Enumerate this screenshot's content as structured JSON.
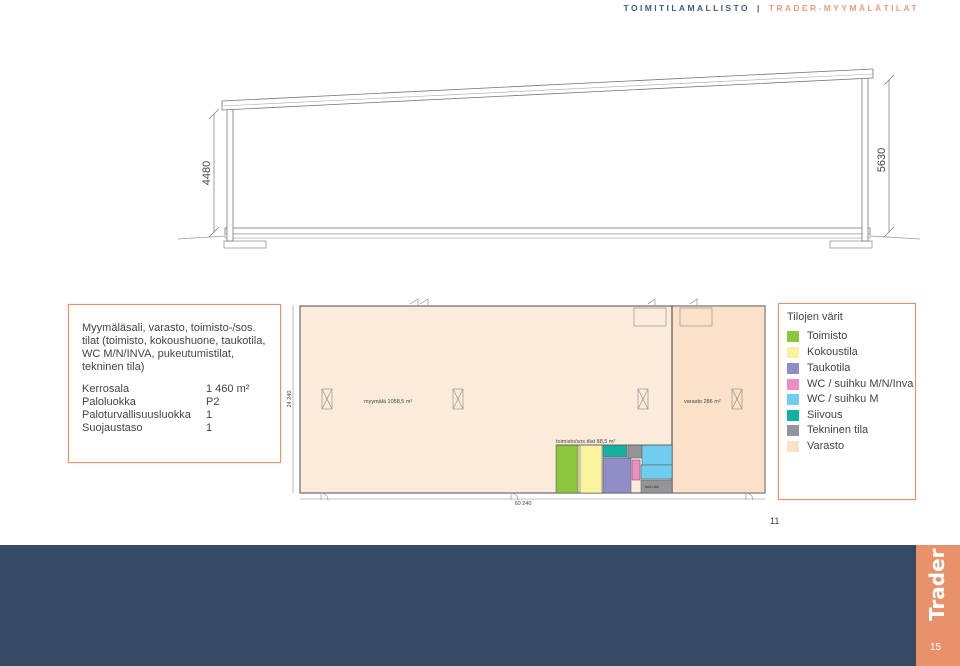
{
  "header": {
    "series": "TOIMITILAMALLISTO",
    "separator": "|",
    "section": "TRADER-MYYMÄLÄTILAT"
  },
  "section_drawing": {
    "height_left": "4480",
    "height_right": "5630"
  },
  "info": {
    "description": "Myymäläsali, varasto, toimisto-/sos. tilat (toimisto, kokoushuone, taukotila, WC M/N/INVA, pukeutumistilat, tekninen tila)",
    "rows": [
      {
        "label": "Kerrosala",
        "value": "1 460 m²"
      },
      {
        "label": "Paloluokka",
        "value": "P2"
      },
      {
        "label": "Paloturvallisuusluokka",
        "value": "1"
      },
      {
        "label": "Suojaustaso",
        "value": "1"
      }
    ]
  },
  "floorplan": {
    "shop_label": "myymälä 1058,5 m²",
    "storage_label": "varasto 286 m²",
    "office_label": "toimisto/sos.tilat 88,5 m²",
    "tech_label": "tekn.tila",
    "dim_width": "60 240",
    "dim_depth": "24 240",
    "colors": {
      "shop": "#fbebda",
      "storage": "#fbe1c8",
      "wall": "#6a6a6a"
    }
  },
  "legend": {
    "title": "Tilojen värit",
    "items": [
      {
        "label": "Toimisto",
        "color": "#8cc63f"
      },
      {
        "label": "Kokoustila",
        "color": "#faf39e"
      },
      {
        "label": "Taukotila",
        "color": "#8f8cc6"
      },
      {
        "label": "WC / suihku M/N/Inva",
        "color": "#ec8ec1"
      },
      {
        "label": "WC / suihku M",
        "color": "#70cdf0"
      },
      {
        "label": "Siivous",
        "color": "#14b0a2"
      },
      {
        "label": "Tekninen tila",
        "color": "#939598"
      },
      {
        "label": "Varasto",
        "color": "#fbe1c8"
      }
    ]
  },
  "page_ref": "11",
  "footer": {
    "brand": "Trader",
    "page": "15"
  }
}
